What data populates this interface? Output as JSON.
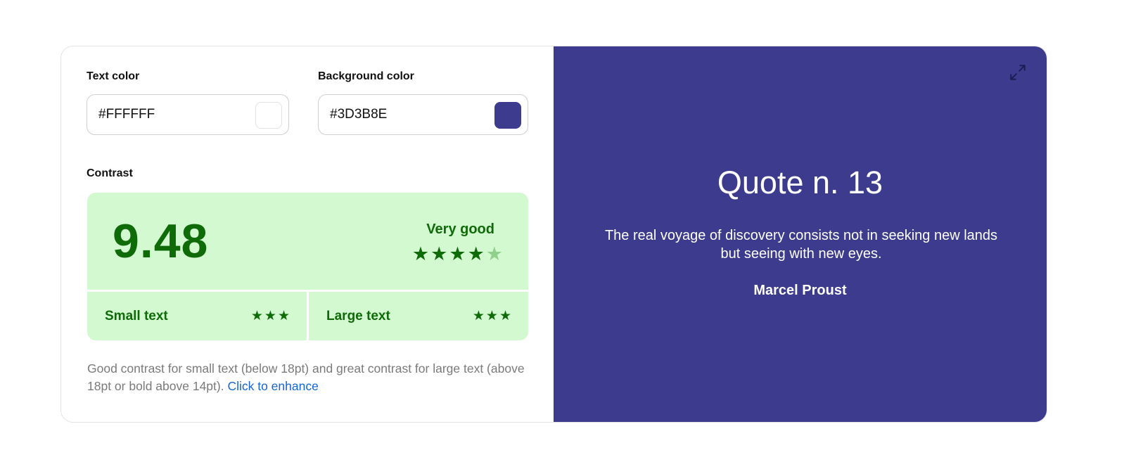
{
  "text_color": {
    "label": "Text color",
    "value": "#FFFFFF",
    "swatch": "#ffffff"
  },
  "background_color": {
    "label": "Background color",
    "value": "#3D3B8E",
    "swatch": "#3d3b8e"
  },
  "contrast": {
    "label": "Contrast",
    "ratio": "9.48",
    "rating": "Very good",
    "stars_filled": 4,
    "stars_total": 5,
    "small_text": {
      "label": "Small text",
      "stars": 3
    },
    "large_text": {
      "label": "Large text",
      "stars": 3
    },
    "colors": {
      "panel": "#d3f9d1",
      "accent": "#0f6a08",
      "star_off": "#8fd08c"
    }
  },
  "note": {
    "text": "Good contrast for small text (below 18pt) and great contrast for large text (above 18pt or bold above 14pt). ",
    "link": "Click to enhance",
    "link_color": "#1566d6"
  },
  "preview": {
    "expand_icon": "expand-arrows-icon",
    "title": "Quote n. 13",
    "quote": "The real voyage of discovery consists not in seeking new lands but seeing with new eyes.",
    "author": "Marcel Proust"
  }
}
